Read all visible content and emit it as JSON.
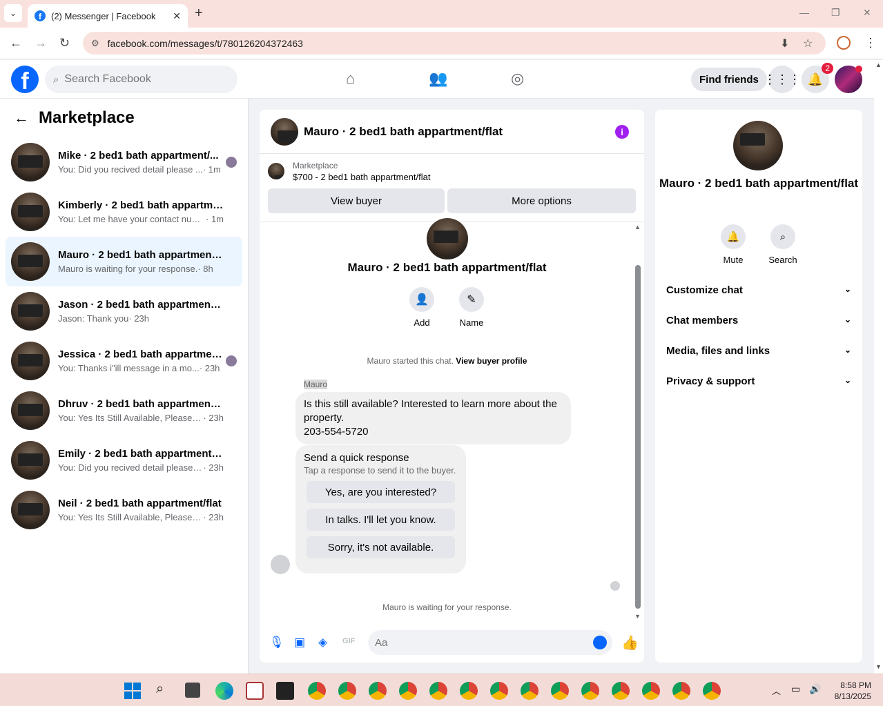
{
  "browser": {
    "tab_title": "(2) Messenger | Facebook",
    "url": "facebook.com/messages/t/780126204372463"
  },
  "topbar": {
    "search_placeholder": "Search Facebook",
    "find_friends": "Find friends",
    "notification_count": "2"
  },
  "sidebar": {
    "title": "Marketplace",
    "conversations": [
      {
        "name": "Mike · 2 bed1 bath appartment/...",
        "preview": "You: Did you recived detail please ...",
        "time": "· 1m"
      },
      {
        "name": "Kimberly · 2 bed1 bath appartmen...",
        "preview": "You: Let me have your contact numb...",
        "time": "· 1m"
      },
      {
        "name": "Mauro · 2 bed1 bath appartment/f...",
        "preview": "Mauro is waiting for your response.",
        "time": "· 8h"
      },
      {
        "name": "Jason · 2 bed1 bath appartment/flat",
        "preview": "Jason: Thank you",
        "time": "· 23h"
      },
      {
        "name": "Jessica · 2 bed1 bath appartmen...",
        "preview": "You: Thanks i\"ill message in a mo...",
        "time": "· 23h"
      },
      {
        "name": "Dhruv · 2 bed1 bath appartment/flat",
        "preview": "You: Yes Its Still Available, Please Sen...",
        "time": "· 23h"
      },
      {
        "name": "Emily · 2 bed1 bath appartment/flat",
        "preview": "You: Did you recived detail please tel...",
        "time": "· 23h"
      },
      {
        "name": "Neil · 2 bed1 bath appartment/flat",
        "preview": "You: Yes Its Still Available, Please Sen...",
        "time": "· 23h"
      }
    ]
  },
  "chat": {
    "title": "Mauro · 2 bed1 bath appartment/flat",
    "marketplace_label": "Marketplace",
    "listing": "$700 - 2 bed1 bath appartment/flat",
    "view_buyer": "View buyer",
    "more_options": "More options",
    "hero_name": "Mauro · 2 bed1 bath appartment/flat",
    "add_label": "Add",
    "name_label": "Name",
    "started_text": "Mauro started this chat.",
    "view_profile": "View buyer profile",
    "sender": "Mauro",
    "message_line1": "Is this still available? Interested to learn more about the property.",
    "message_line2": "203-554-5720",
    "quick_title": "Send a quick response",
    "quick_sub": "Tap a response to send it to the buyer.",
    "quick_responses": [
      "Yes, are you interested?",
      "In talks. I'll let you know.",
      "Sorry, it's not available."
    ],
    "waiting": "Mauro is waiting for your response.",
    "composer_placeholder": "Aa"
  },
  "info_panel": {
    "name": "Mauro · 2 bed1 bath appartment/flat",
    "mute": "Mute",
    "search": "Search",
    "sections": [
      "Customize chat",
      "Chat members",
      "Media, files and links",
      "Privacy & support"
    ]
  },
  "taskbar": {
    "time": "8:58 PM",
    "date": "8/13/2025"
  }
}
